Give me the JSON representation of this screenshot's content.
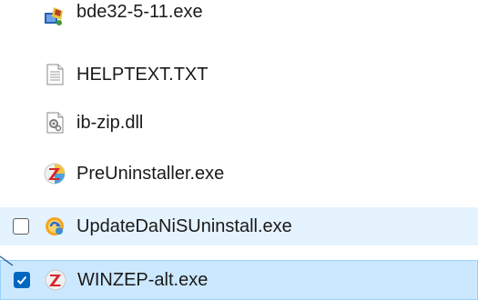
{
  "files": [
    {
      "name": "bde32-5-11.exe",
      "icon": "installer-icon"
    },
    {
      "name": "HELPTEXT.TXT",
      "icon": "text-file-icon"
    },
    {
      "name": "ib-zip.dll",
      "icon": "dll-file-icon"
    },
    {
      "name": "PreUninstaller.exe",
      "icon": "winzep-app-icon"
    },
    {
      "name": "UpdateDaNiSUninstall.exe",
      "icon": "update-app-icon",
      "checked": false
    },
    {
      "name": "WINZEP-alt.exe",
      "icon": "winzep-app-icon",
      "checked": true
    }
  ]
}
